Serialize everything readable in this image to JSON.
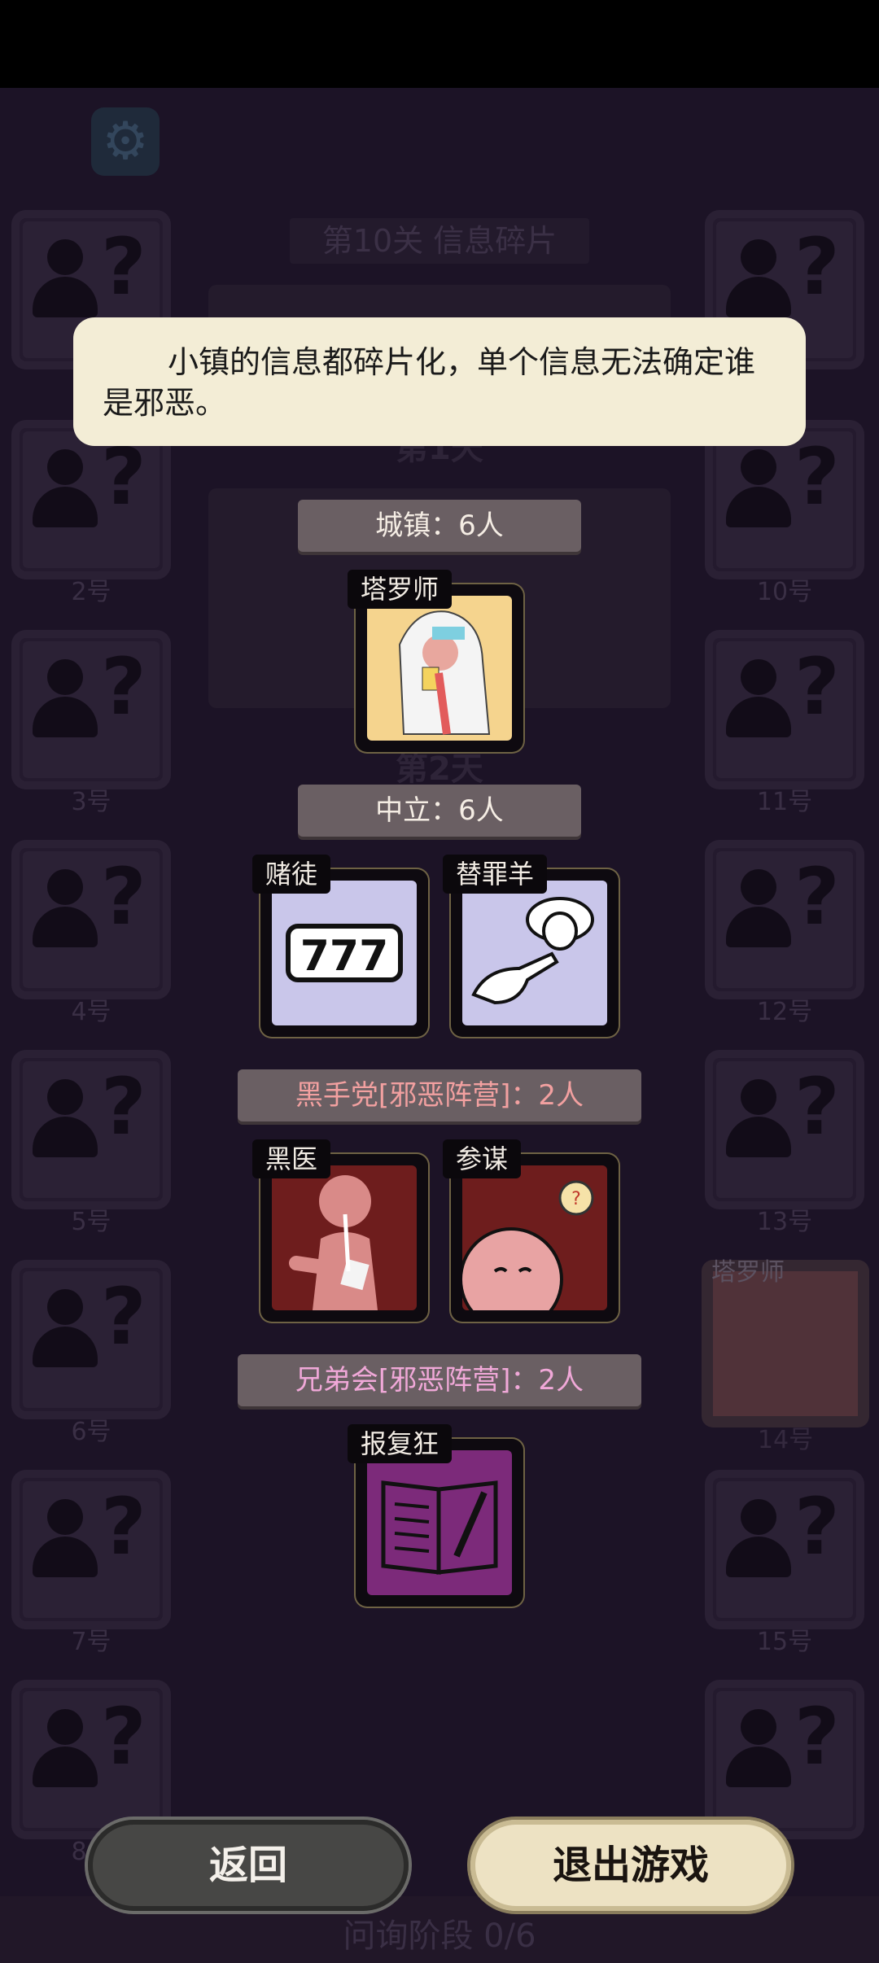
{
  "settings_icon": "gear-icon",
  "background": {
    "level_title": "第10关 信息碎片",
    "day1": "第1天",
    "day2": "第2天",
    "phase": "问询阶段 0/6",
    "slots_left": [
      "",
      "2号",
      "3号",
      "4号",
      "5号",
      "6号",
      "7号",
      "8号"
    ],
    "slots_right": [
      "",
      "10号",
      "11号",
      "12号",
      "13号",
      "14号",
      "15号",
      ""
    ],
    "ghost_label": "塔罗师"
  },
  "tooltip": {
    "text": "小镇的信息都碎片化，单个信息无法确定谁是邪恶。"
  },
  "groups": {
    "town": {
      "header": "城镇：6人",
      "cards": [
        {
          "label": "塔罗师",
          "icon": "tarot-reader-icon"
        }
      ]
    },
    "neutral": {
      "header": "中立：6人",
      "cards": [
        {
          "label": "赌徒",
          "icon": "slot-777-icon"
        },
        {
          "label": "替罪羊",
          "icon": "pointing-sheep-icon"
        }
      ]
    },
    "black_hand": {
      "header": "黑手党[邪恶阵营]：2人",
      "cards": [
        {
          "label": "黑医",
          "icon": "bandaged-figure-icon"
        },
        {
          "label": "参谋",
          "icon": "lightbulb-advisor-icon"
        }
      ]
    },
    "brotherhood": {
      "header": "兄弟会[邪恶阵营]：2人",
      "cards": [
        {
          "label": "报复狂",
          "icon": "notebook-knife-icon"
        }
      ]
    }
  },
  "colors": {
    "town_bg": "#f5d48e",
    "neutral_bg": "#c9c6ea",
    "evil_bg": "#6e1d1d",
    "brotherhood_bg": "#7c2a7a",
    "evil_header_text": "#f2a0a0",
    "brotherhood_header_text": "#f0a8d8"
  },
  "buttons": {
    "back": "返回",
    "exit": "退出游戏"
  }
}
